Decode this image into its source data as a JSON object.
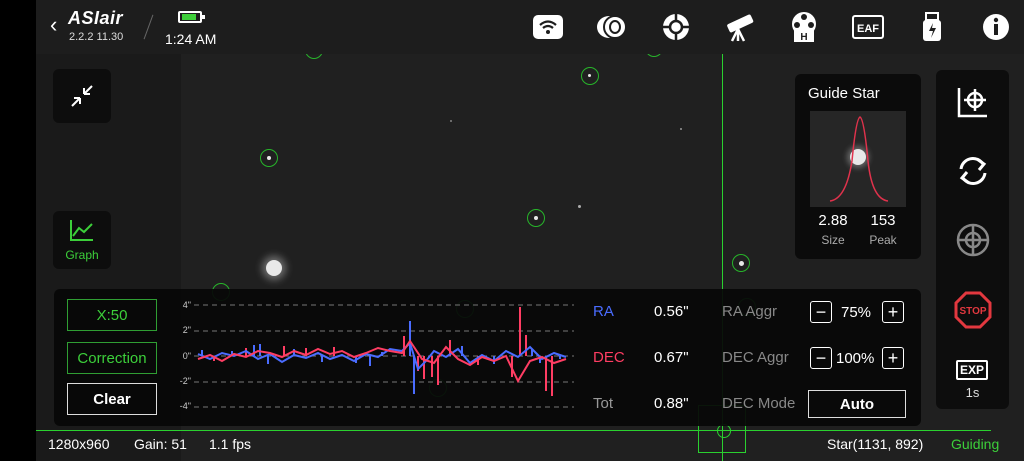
{
  "header": {
    "app_name": "ASIair",
    "version": "2.2.2 11.30",
    "time": "1:24 AM",
    "icons": [
      "back-icon",
      "wifi-icon",
      "camera-icon",
      "guide-scope-icon",
      "telescope-icon",
      "filter-wheel-icon",
      "eaf-focuser-icon",
      "usb-storage-icon",
      "info-icon"
    ],
    "eaf_label": "EAF",
    "filter_label": "H"
  },
  "left_controls": {
    "graph_label": "Graph"
  },
  "graph_panel": {
    "scale_button": "X:50",
    "correction_button": "Correction",
    "clear_button": "Clear",
    "y_ticks": [
      "4\"",
      "2\"",
      "0\"",
      "-2\"",
      "-4\""
    ],
    "ra_label": "RA",
    "dec_label": "DEC",
    "tot_label": "Tot",
    "ra_value": "0.56\"",
    "dec_value": "0.67\"",
    "tot_value": "0.88\"",
    "ra_aggr_label": "RA Aggr",
    "dec_aggr_label": "DEC Aggr",
    "dec_mode_label": "DEC Mode",
    "ra_aggr_value": "75%",
    "dec_aggr_value": "100%",
    "dec_mode_value": "Auto",
    "colors": {
      "ra": "#4a6cff",
      "dec": "#ff3d63",
      "accent": "#3ccf3a"
    }
  },
  "guide_star": {
    "title": "Guide Star",
    "size_value": "2.88",
    "size_label": "Size",
    "peak_value": "153",
    "peak_label": "Peak"
  },
  "right_panel": {
    "icons": [
      "calibrate-icon",
      "refresh-loop-icon",
      "guide-target-icon",
      "stop-icon"
    ],
    "stop_label": "STOP",
    "exp_label": "EXP",
    "exp_value": "1s"
  },
  "status_bar": {
    "resolution": "1280x960",
    "gain": "Gain: 51",
    "fps": "1.1 fps",
    "star_position": "Star(1131, 892)",
    "state": "Guiding"
  }
}
